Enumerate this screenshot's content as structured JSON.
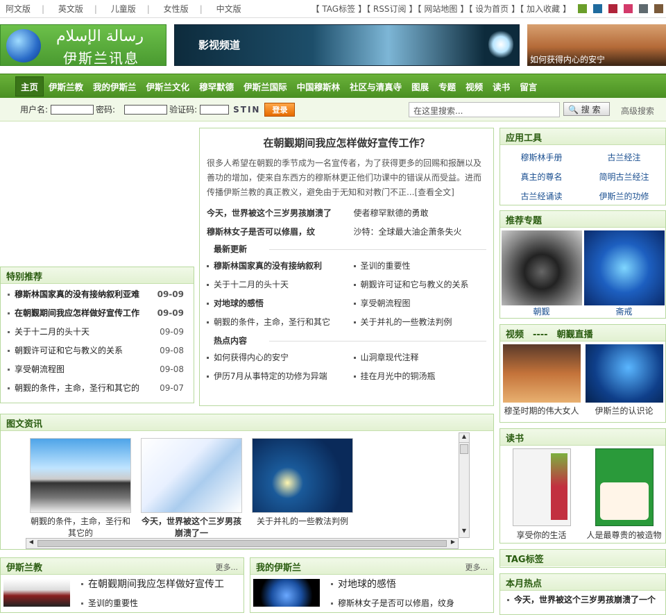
{
  "topbar": {
    "langs": [
      "阿文版",
      "英文版",
      "儿童版",
      "女性版",
      "中文版"
    ],
    "links": [
      "【 TAG标签",
      "】【 RSS订阅",
      "】【 网站地图",
      "】【 设为首页",
      "】【 加入收藏",
      "】"
    ],
    "swatches": [
      "#6a9e2a",
      "#1f6b9e",
      "#b0243a",
      "#d33a6a",
      "#5f6a6f",
      "#7a5a3a"
    ]
  },
  "banner": {
    "logo_ar": "رسالة الإسلام",
    "logo_cn": "伊斯兰讯息",
    "video_title": "影视频道",
    "sunset_caption": "如何获得内心的安宁"
  },
  "nav": {
    "items": [
      "主页",
      "伊斯兰教",
      "我的伊斯兰",
      "伊斯兰文化",
      "穆罕默德",
      "伊斯兰国际",
      "中国穆斯林",
      "社区与清真寺",
      "图展",
      "专题",
      "视频",
      "读书",
      "留言"
    ]
  },
  "login": {
    "user_label": "用户名:",
    "pass_label": "密码:",
    "code_label": "验证码:",
    "code": "STIN",
    "button": "登录",
    "search_placeholder": "在这里搜索...",
    "search_button": "搜 索",
    "advanced": "高级搜索"
  },
  "special": {
    "title": "特别推荐",
    "items": [
      {
        "text": "穆斯林国家真的没有接纳叙利亚难",
        "date": "09-09",
        "bold": true
      },
      {
        "text": "在朝觐期间我应怎样做好宣传工作",
        "date": "09-09",
        "bold": true
      },
      {
        "text": "关于十二月的头十天",
        "date": "09-09",
        "bold": false
      },
      {
        "text": "朝觐许可证和它与教义的关系",
        "date": "09-08",
        "bold": false
      },
      {
        "text": "享受朝流程图",
        "date": "09-08",
        "bold": false
      },
      {
        "text": "朝觐的条件，主命，圣行和其它的",
        "date": "09-07",
        "bold": false
      }
    ]
  },
  "feature": {
    "title": "在朝觐期间我应怎样做好宣传工作？",
    "summary": "很多人希望在朝觐的季节成为一名宣传者，为了获得更多的回赐和报酬以及善功的增加，使来自东西方的穆斯林更正他们功课中的错误从而受益。进而传播伊斯兰教的真正教义，避免由于无知和对教门不正...[查看全文]",
    "highlights": [
      "今天，世界被这个三岁男孩崩溃了",
      "使者穆罕默德的勇敢",
      "穆斯林女子是否可以修眉，纹",
      "沙特：全球最大油企萧条失火"
    ],
    "latest_title": "最新更新",
    "latest": [
      "穆斯林国家真的没有接纳叙利",
      "圣训的重要性",
      "关于十二月的头十天",
      "朝觐许可证和它与教义的关系",
      "对地球的感悟",
      "享受朝流程图",
      "朝觐的条件，主命，圣行和其它",
      "关于并礼的一些教法判例"
    ],
    "hot_title": "热点内容",
    "hot": [
      "如何获得内心的安宁",
      "山洞章现代注释",
      "伊历7月从事特定的功修为异端",
      "挂在月光中的铜汤瓶"
    ]
  },
  "tools": {
    "title": "应用工具",
    "items": [
      "穆斯林手册",
      "古兰经注",
      "真主的尊名",
      "简明古兰经注",
      "古兰经诵读",
      "伊斯兰的功修"
    ]
  },
  "topics": {
    "title": "推荐专题",
    "items": [
      "朝觐",
      "斋戒"
    ]
  },
  "videos": {
    "title": "视频　----　朝觐直播",
    "items": [
      "穆圣时期的伟大女人",
      "伊斯兰的认识论"
    ]
  },
  "books": {
    "title": "读书",
    "items": [
      "享受你的生活",
      "人是最尊贵的被造物"
    ]
  },
  "tags": {
    "title": "TAG标签"
  },
  "monthly": {
    "title": "本月热点",
    "first": "今天，世界被这个三岁男孩崩溃了一个"
  },
  "gallery": {
    "title": "图文资讯",
    "items": [
      "朝觐的条件，主命，圣行和其它的",
      "今天，世界被这个三岁男孩崩溃了一",
      "关于并礼的一些教法判例"
    ]
  },
  "islam": {
    "title": "伊斯兰教",
    "more": "更多...",
    "items": [
      "在朝觐期间我应怎样做好宣传工",
      "圣训的重要性"
    ]
  },
  "myislam": {
    "title": "我的伊斯兰",
    "more": "更多...",
    "items": [
      "对地球的感悟",
      "穆斯林女子是否可以修眉，纹身"
    ]
  }
}
